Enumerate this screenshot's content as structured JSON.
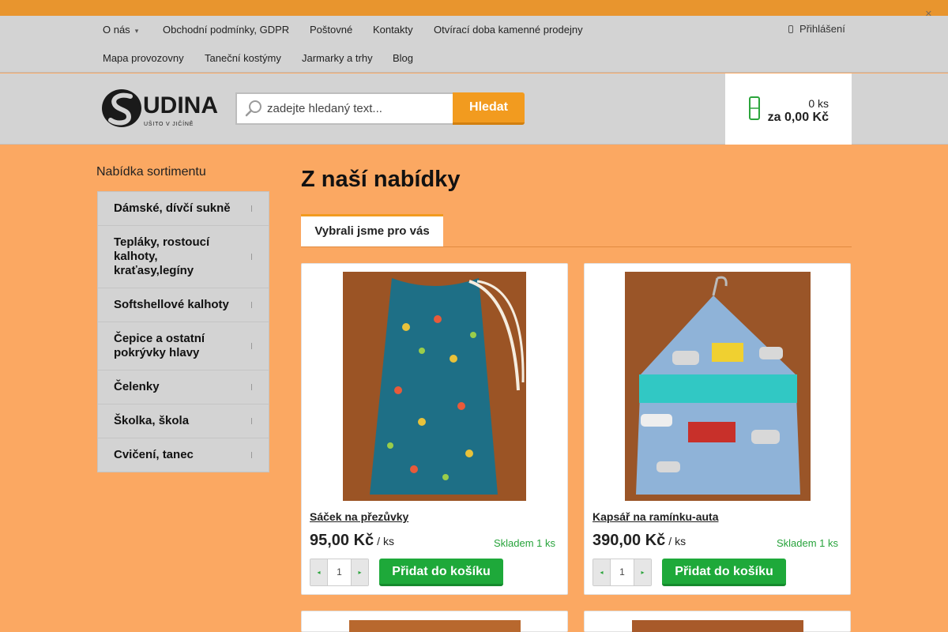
{
  "colors": {
    "accent": "#f29b1f",
    "background": "#fba862",
    "panel": "#d3d3d3",
    "green": "#1ea93a",
    "stock": "#27a33b"
  },
  "top_strip": {
    "close_icon": "close-icon"
  },
  "menu": {
    "row1": [
      "O nás",
      "Obchodní podmínky, GDPR",
      "Poštovné",
      "Kontakty",
      "Otvírací doba kamenné prodejny"
    ],
    "row2": [
      "Mapa provozovny",
      "Taneční kostýmy",
      "Jarmarky a trhy",
      "Blog"
    ],
    "login": "Přihlášení"
  },
  "header": {
    "logo_text": "UDINA",
    "logo_tagline": "UŠITO V JIČÍNĚ",
    "search_placeholder": "zadejte hledaný text...",
    "search_button": "Hledat",
    "cart_count": "0 ks",
    "cart_total": "za 0,00 Kč"
  },
  "sidebar": {
    "title": "Nabídka sortimentu",
    "items": [
      "Dámské, dívčí sukně",
      "Tepláky, rostoucí kalhoty, kraťasy,legíny",
      "Softshellové kalhoty",
      "Čepice a ostatní pokrývky hlavy",
      "Čelenky",
      "Školka, škola",
      "Cvičení, tanec"
    ]
  },
  "main": {
    "title": "Z naší nabídky",
    "tab": "Vybrali jsme pro vás"
  },
  "products": [
    {
      "name": "Sáček na přezůvky",
      "price": "95,00 Kč",
      "unit": "/ ks",
      "stock": "Skladem 1 ks",
      "qty": "1",
      "add_label": "Přidat do košíku"
    },
    {
      "name": "Kapsář na ramínku-auta",
      "price": "390,00 Kč",
      "unit": "/ ks",
      "stock": "Skladem 1 ks",
      "qty": "1",
      "add_label": "Přidat do košíku"
    }
  ]
}
